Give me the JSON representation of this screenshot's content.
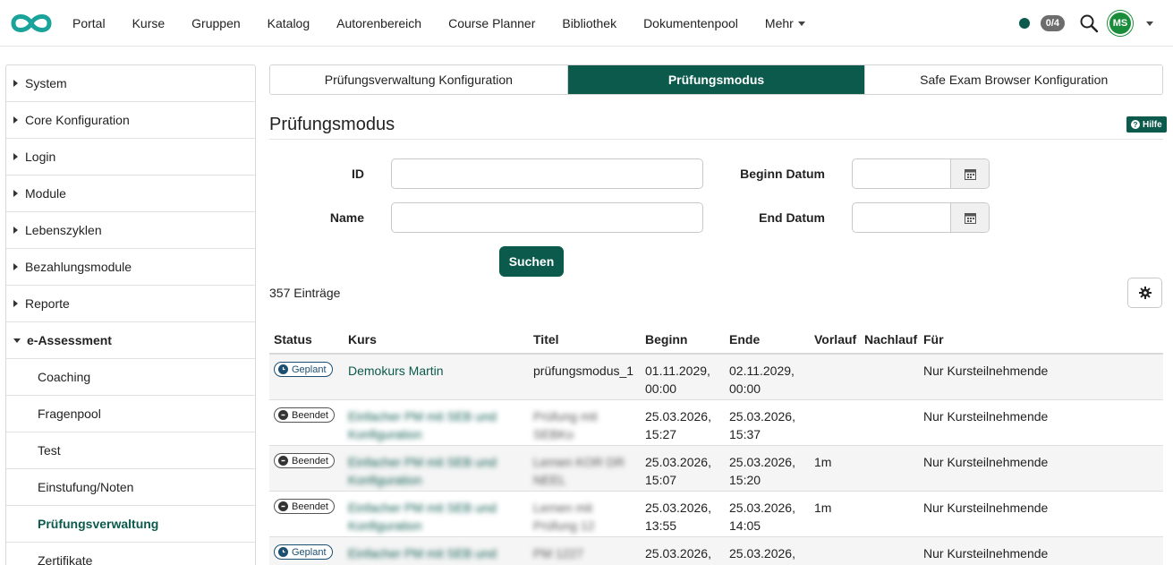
{
  "nav": {
    "links": [
      "Portal",
      "Kurse",
      "Gruppen",
      "Katalog",
      "Autorenbereich",
      "Course Planner",
      "Bibliothek",
      "Dokumentenpool",
      "Mehr"
    ],
    "badge": "0/4",
    "avatar": "MS",
    "icons": [
      "logo-icon",
      "search-icon",
      "chevron-down-icon"
    ]
  },
  "sidebar": {
    "items": [
      {
        "label": "System"
      },
      {
        "label": "Core Konfiguration"
      },
      {
        "label": "Login"
      },
      {
        "label": "Module"
      },
      {
        "label": "Lebenszyklen"
      },
      {
        "label": "Bezahlungsmodule"
      },
      {
        "label": "Reporte"
      },
      {
        "label": "e-Assessment"
      },
      {
        "label": "Coaching"
      },
      {
        "label": "Fragenpool"
      },
      {
        "label": "Test"
      },
      {
        "label": "Einstufung/Noten"
      },
      {
        "label": "Prüfungsverwaltung"
      },
      {
        "label": "Zertifikate"
      }
    ]
  },
  "tabs": [
    {
      "label": "Prüfungsverwaltung Konfiguration"
    },
    {
      "label": "Prüfungsmodus"
    },
    {
      "label": "Safe Exam Browser Konfiguration"
    }
  ],
  "page": {
    "title": "Prüfungsmodus",
    "help": "Hilfe"
  },
  "form": {
    "id_label": "ID",
    "id_value": "",
    "name_label": "Name",
    "name_value": "",
    "begin_label": "Beginn Datum",
    "begin_value": "",
    "end_label": "End Datum",
    "end_value": "",
    "search_button": "Suchen"
  },
  "entries": "357 Einträge",
  "table": {
    "headers": [
      "Status",
      "Kurs",
      "Titel",
      "Beginn",
      "Ende",
      "Vorlauf",
      "Nachlauf",
      "Für"
    ],
    "rows": [
      {
        "status": "Geplant",
        "course": "Demokurs Martin",
        "title": "prüfungsmodus_1",
        "begin1": "01.11.2029,",
        "begin2": "00:00",
        "end1": "02.11.2029,",
        "end2": "00:00",
        "pre": "",
        "post": "",
        "for": "Nur Kursteilnehmende"
      },
      {
        "status": "Beendet",
        "course": "Einfacher PM mit SEB und",
        "course2": "Konfiguration",
        "title": "Prüfung mit",
        "title2": "SEBKo",
        "begin1": "25.03.2026,",
        "begin2": "15:27",
        "end1": "25.03.2026,",
        "end2": "15:37",
        "pre": "",
        "post": "",
        "for": "Nur Kursteilnehmende"
      },
      {
        "status": "Beendet",
        "course": "Einfacher PM mit SEB und",
        "course2": "Konfiguration",
        "title": "Lernen KOR DR",
        "title2": "NEEL",
        "begin1": "25.03.2026,",
        "begin2": "15:07",
        "end1": "25.03.2026,",
        "end2": "15:20",
        "pre": "1m",
        "post": "",
        "for": "Nur Kursteilnehmende"
      },
      {
        "status": "Beendet",
        "course": "Einfacher PM mit SEB und",
        "course2": "Konfiguration",
        "title": "Lernen mit",
        "title2": "Prüfung 12",
        "begin1": "25.03.2026,",
        "begin2": "13:55",
        "end1": "25.03.2026,",
        "end2": "14:05",
        "pre": "1m",
        "post": "",
        "for": "Nur Kursteilnehmende"
      },
      {
        "status": "Geplant",
        "course": "Einfacher PM mit SEB und",
        "course2": "",
        "title": "PM 1227",
        "title2": "",
        "begin1": "25.03.2026,",
        "begin2": "",
        "end1": "25.03.2026,",
        "end2": "",
        "pre": "",
        "post": "",
        "for": "Nur Kursteilnehmende"
      }
    ]
  },
  "colors": {
    "brand": "#0b5a4c",
    "status_planned": "#1b4f72"
  }
}
